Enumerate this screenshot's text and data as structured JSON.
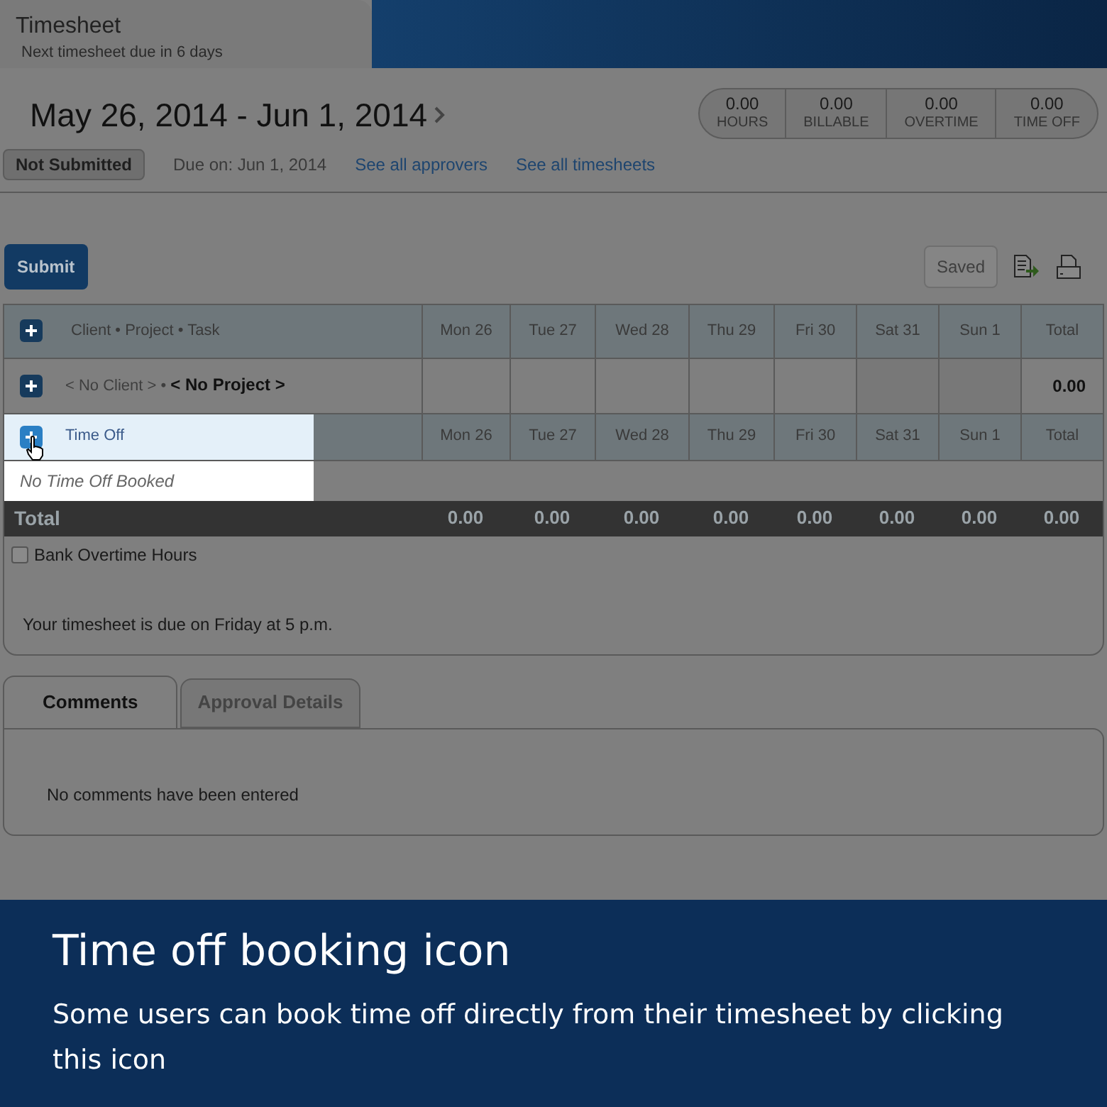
{
  "header": {
    "title": "Timesheet",
    "subtitle": "Next timesheet due in 6 days"
  },
  "period": {
    "label": "May 26, 2014 - Jun 1, 2014"
  },
  "stats": [
    {
      "value": "0.00",
      "label": "HOURS"
    },
    {
      "value": "0.00",
      "label": "BILLABLE"
    },
    {
      "value": "0.00",
      "label": "OVERTIME"
    },
    {
      "value": "0.00",
      "label": "TIME OFF"
    }
  ],
  "status": "Not Submitted",
  "due": "Due on: Jun 1, 2014",
  "links": [
    "See all approvers",
    "See all timesheets"
  ],
  "submit": "Submit",
  "saved": {
    "label": "Saved",
    "disabled": true
  },
  "table": {
    "columns": [
      "Client • Project • Task",
      "Mon 26",
      "Tue 27",
      "Wed 28",
      "Thu 29",
      "Fri 30",
      "Sat 31",
      "Sun 1",
      "Total"
    ],
    "rows": [
      {
        "client": "< No Client > •",
        "project": "< No Project >",
        "total": "0.00"
      }
    ]
  },
  "time_off": {
    "columns": [
      "Time Off",
      "Mon 26",
      "Tue 27",
      "Wed 28",
      "Thu 29",
      "Fri 30",
      "Sat 31",
      "Sun 1",
      "Total"
    ],
    "empty": "No Time Off Booked"
  },
  "totals": {
    "label": "Total",
    "values": [
      "0.00",
      "0.00",
      "0.00",
      "0.00",
      "0.00",
      "0.00",
      "0.00",
      "0.00"
    ]
  },
  "bank_overtime": {
    "label": "Bank Overtime Hours",
    "checked": false
  },
  "due_note": "Your timesheet is due on Friday at 5 p.m.",
  "tabs": [
    {
      "label": "Comments",
      "selected": true
    },
    {
      "label": "Approval Details",
      "selected": false
    }
  ],
  "comments_empty": "No comments have been entered",
  "caption": {
    "title": "Time off booking icon",
    "text": "Some users can book time off directly from their timesheet by clicking this icon"
  }
}
